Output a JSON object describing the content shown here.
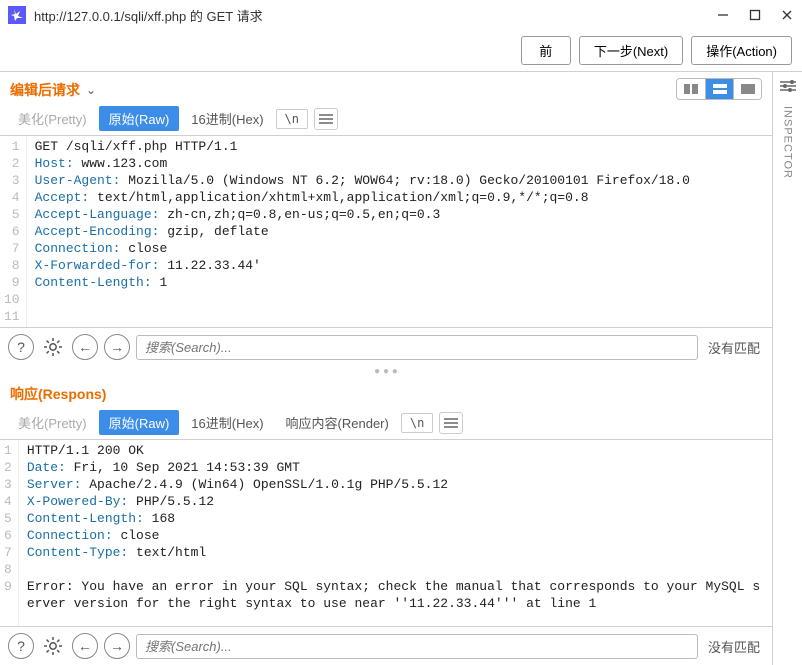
{
  "window": {
    "title": "http://127.0.0.1/sqli/xff.php 的 GET 请求"
  },
  "toolbar": {
    "prev": "前",
    "next": "下一步(Next)",
    "action": "操作(Action)"
  },
  "inspector_label": "INSPECTOR",
  "request": {
    "title": "编辑后请求",
    "tabs": {
      "pretty": "美化(Pretty)",
      "raw": "原始(Raw)",
      "hex": "16进制(Hex)",
      "nl": "\\n"
    },
    "lines": [
      {
        "n": "1",
        "raw": "GET /sqli/xff.php HTTP/1.1"
      },
      {
        "n": "2",
        "name": "Host",
        "val": " www.123.com"
      },
      {
        "n": "3",
        "name": "User-Agent",
        "val": " Mozilla/5.0 (Windows NT 6.2; WOW64; rv:18.0) Gecko/20100101 Firefox/18.0"
      },
      {
        "n": "4",
        "name": "Accept",
        "val": " text/html,application/xhtml+xml,application/xml;q=0.9,*/*;q=0.8"
      },
      {
        "n": "5",
        "name": "Accept-Language",
        "val": " zh-cn,zh;q=0.8,en-us;q=0.5,en;q=0.3"
      },
      {
        "n": "6",
        "name": "Accept-Encoding",
        "val": " gzip, deflate"
      },
      {
        "n": "7",
        "name": "Connection",
        "val": " close"
      },
      {
        "n": "8",
        "name": "X-Forwarded-for",
        "val": " 11.22.33.44'"
      },
      {
        "n": "9",
        "name": "Content-Length",
        "val": " 1"
      },
      {
        "n": "10",
        "raw": ""
      },
      {
        "n": "11",
        "raw": ""
      }
    ],
    "search_placeholder": "搜索(Search)...",
    "no_match": "没有匹配"
  },
  "response": {
    "title": "响应(Respons)",
    "tabs": {
      "pretty": "美化(Pretty)",
      "raw": "原始(Raw)",
      "hex": "16进制(Hex)",
      "render": "响应内容(Render)",
      "nl": "\\n"
    },
    "lines": [
      {
        "n": "1",
        "raw": "HTTP/1.1 200 OK"
      },
      {
        "n": "2",
        "name": "Date",
        "val": " Fri, 10 Sep 2021 14:53:39 GMT"
      },
      {
        "n": "3",
        "name": "Server",
        "val": " Apache/2.4.9 (Win64) OpenSSL/1.0.1g PHP/5.5.12"
      },
      {
        "n": "4",
        "name": "X-Powered-By",
        "val": " PHP/5.5.12"
      },
      {
        "n": "5",
        "name": "Content-Length",
        "val": " 168"
      },
      {
        "n": "6",
        "name": "Connection",
        "val": " close"
      },
      {
        "n": "7",
        "name": "Content-Type",
        "val": " text/html"
      },
      {
        "n": "8",
        "raw": ""
      },
      {
        "n": "9",
        "raw": "Error: You have an error in your SQL syntax; check the manual that corresponds to your MySQL server version for the right syntax to use near ''11.22.33.44''' at line 1"
      }
    ],
    "search_placeholder": "搜索(Search)...",
    "no_match": "没有匹配"
  }
}
